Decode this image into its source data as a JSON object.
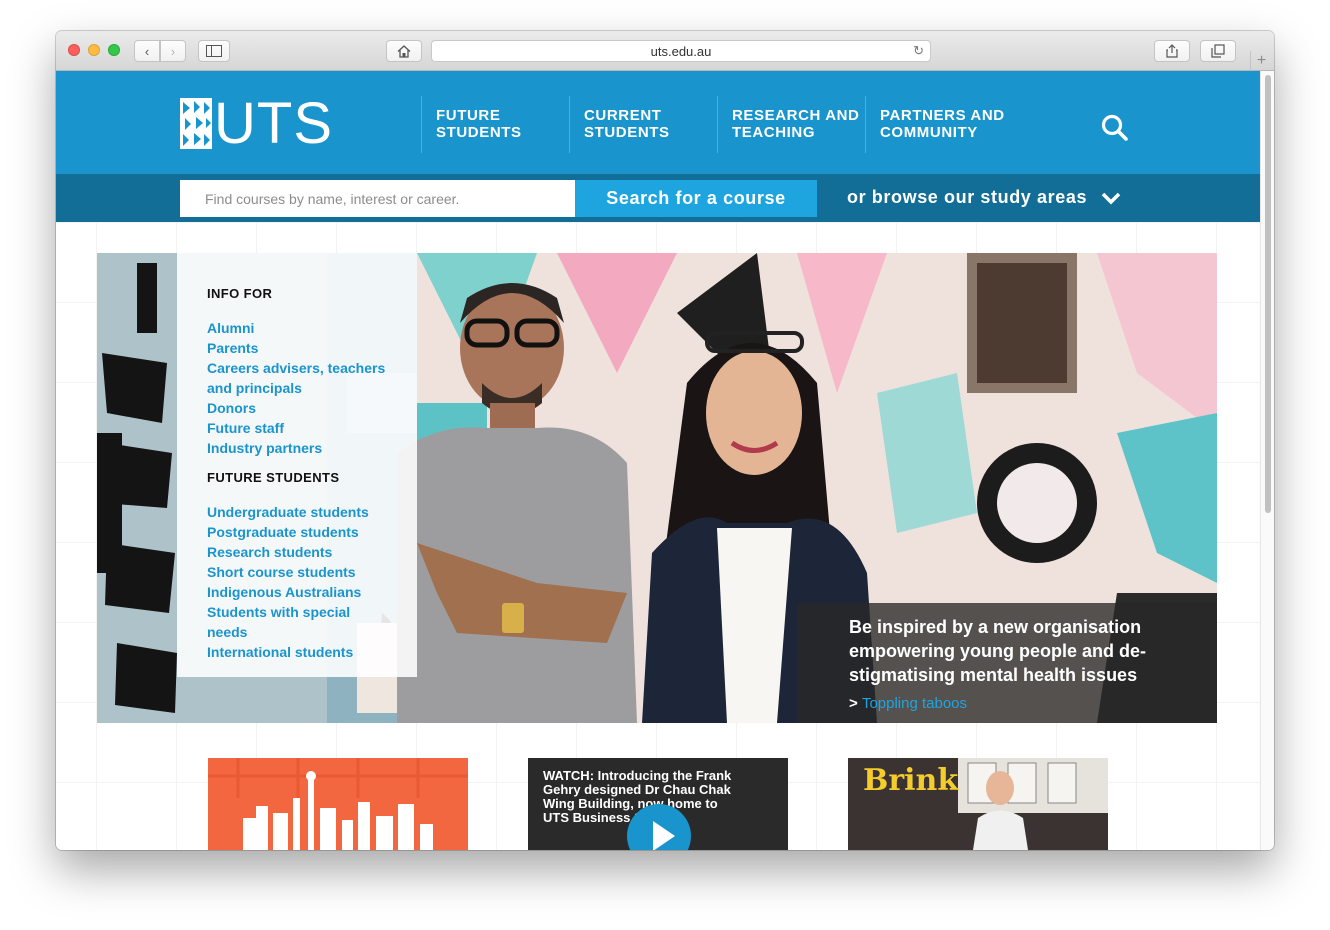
{
  "browser": {
    "url": "uts.edu.au",
    "buttons": [
      "back",
      "forward",
      "sidebar",
      "home",
      "share",
      "tabs",
      "new-tab"
    ]
  },
  "header": {
    "logo_text": "UTS",
    "nav": [
      "FUTURE\nSTUDENTS",
      "CURRENT\nSTUDENTS",
      "RESEARCH AND\nTEACHING",
      "PARTNERS AND\nCOMMUNITY"
    ],
    "accent": "#1a94cd"
  },
  "course_search": {
    "placeholder": "Find courses by name, interest or career.",
    "button": "Search for a course",
    "browse": "or browse our study areas"
  },
  "info_panel": {
    "heading1": "INFO FOR",
    "links1": [
      "Alumni",
      "Parents",
      "Careers advisers, teachers and principals",
      "Donors",
      "Future staff",
      "Industry partners"
    ],
    "heading2": "FUTURE STUDENTS",
    "links2": [
      "Undergraduate students",
      "Postgraduate students",
      "Research students",
      "Short course students",
      "Indigenous Australians",
      "Students with special needs",
      "International students"
    ]
  },
  "hero_caption": {
    "text": "Be inspired by a new organisation empowering young people and de-stigmatising mental health issues",
    "prefix": ">",
    "link": "Toppling taboos"
  },
  "tiles": {
    "video_title": "WATCH: Introducing the Frank Gehry designed Dr Chau Chak Wing Building, now home to UTS Business School",
    "brink": "Brink"
  }
}
